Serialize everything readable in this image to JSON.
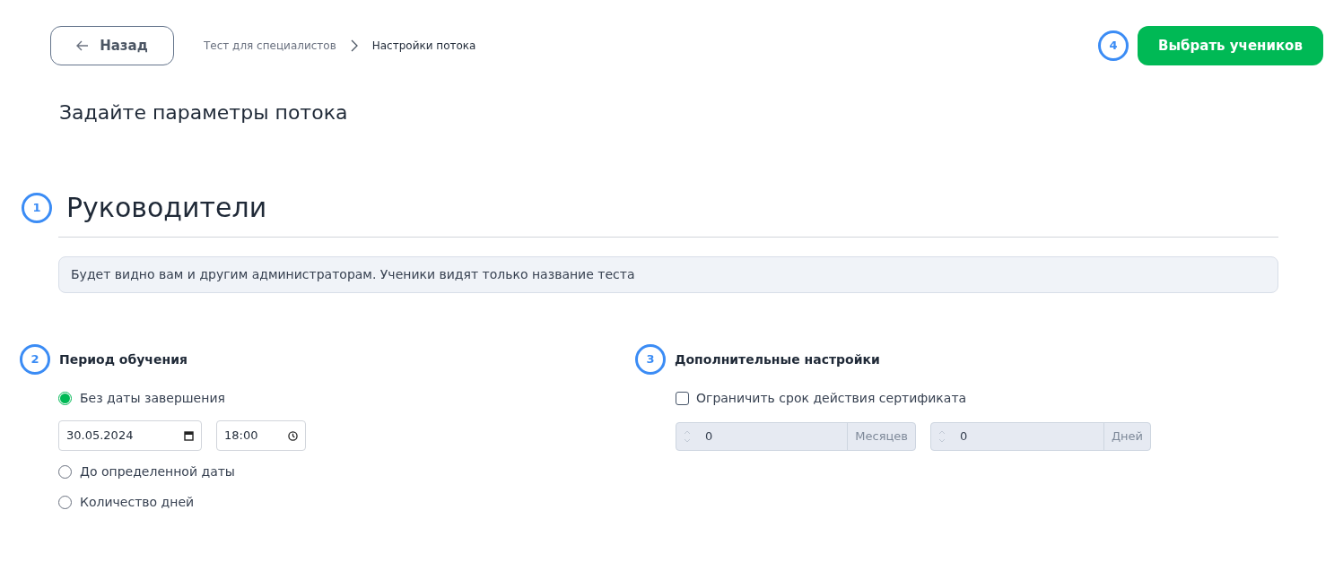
{
  "header": {
    "back_button": {
      "label": "Назад"
    },
    "breadcrumbs": [
      {
        "label": "Тест для специалистов",
        "current": false
      },
      {
        "label": "Настройки потока",
        "current": true
      }
    ],
    "step_badge": "4",
    "primary_button": {
      "label": "Выбрать учеников"
    }
  },
  "page_title": "Задайте параметры потока",
  "name_section": {
    "step_badge": "1",
    "title": "Руководители",
    "description": "Будет видно вам и другим администраторам. Ученики видят только название теста"
  },
  "period_section": {
    "step_badge": "2",
    "heading": "Период обучения",
    "options": [
      {
        "label": "Без даты завершения",
        "selected": true,
        "date": "30.05.2024",
        "time": "18:00"
      },
      {
        "label": "До определенной даты",
        "selected": false
      },
      {
        "label": "Количество дней",
        "selected": false
      }
    ]
  },
  "extra_section": {
    "step_badge": "3",
    "heading": "Дополнительные настройки",
    "checkbox": {
      "label": "Ограничить срок действия сертификата",
      "checked": false
    },
    "fields": [
      {
        "value": "0",
        "unit": "Месяцев",
        "disabled": true
      },
      {
        "value": "0",
        "unit": "Дней",
        "disabled": true
      }
    ]
  }
}
